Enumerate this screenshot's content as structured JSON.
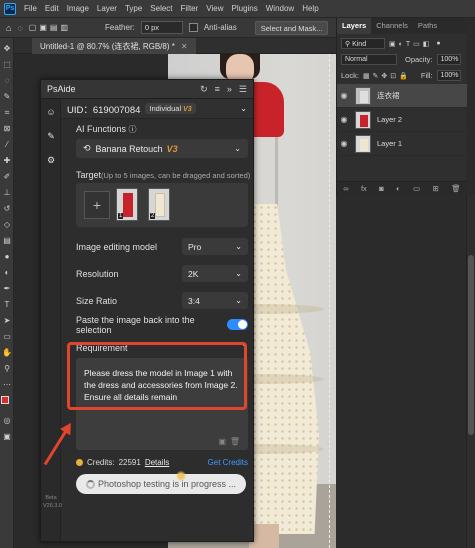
{
  "menubar": {
    "items": [
      "File",
      "Edit",
      "Image",
      "Layer",
      "Type",
      "Select",
      "Filter",
      "View",
      "Plugins",
      "Window",
      "Help"
    ]
  },
  "options": {
    "feather_label": "Feather:",
    "feather_value": "0 px",
    "antialias_label": "Anti-alias",
    "select_mask": "Select and Mask..."
  },
  "document": {
    "tab_title": "Untitled-1 @ 80.7% (连衣裙, RGB/8) *"
  },
  "layers_panel": {
    "tabs": [
      "Layers",
      "Channels",
      "Paths"
    ],
    "filter_label": "Kind",
    "blend_mode": "Normal",
    "opacity_label": "Opacity:",
    "opacity_value": "100%",
    "lock_label": "Lock:",
    "fill_label": "Fill:",
    "fill_value": "100%",
    "layers": [
      {
        "name": "连衣裙"
      },
      {
        "name": "Layer 2"
      },
      {
        "name": "Layer 1"
      }
    ],
    "footer_icons": [
      "link-icon",
      "fx-icon",
      "mask-icon",
      "adjustment-icon",
      "group-icon",
      "new-layer-icon",
      "trash-icon"
    ]
  },
  "psaide": {
    "title": "PsAide",
    "uid": "UID：619007084",
    "plan": "Individual",
    "plan_tag": "V3",
    "ai_functions_label": "AI Functions",
    "function_name": "Banana Retouch",
    "function_tag": "V3",
    "target_label": "Target",
    "target_hint": "(Up to 5 images, can be dragged and sorted)",
    "target_images": [
      "1",
      "2"
    ],
    "model_label": "Image editing model",
    "model_value": "Pro",
    "resolution_label": "Resolution",
    "resolution_value": "2K",
    "size_label": "Size Ratio",
    "size_value": "3:4",
    "paste_back_label": "Paste the image back into the selection",
    "paste_back_enabled": true,
    "requirement_label": "Requirement",
    "requirement_text": "Please dress the model in Image 1 with the dress and accessories from Image 2. Ensure all details remain",
    "credits_label": "Credits:",
    "credits_value": "22591",
    "details_label": "Details",
    "get_credits_label": "Get Credits",
    "progress_label": "Photoshop testing is in progress ...",
    "beta_label": "Beta",
    "version_label": "V26.3.0"
  },
  "colors": {
    "accent_blue": "#2f8cff",
    "annotation_red": "#e0462b",
    "tag_gold": "#d59a3a"
  }
}
